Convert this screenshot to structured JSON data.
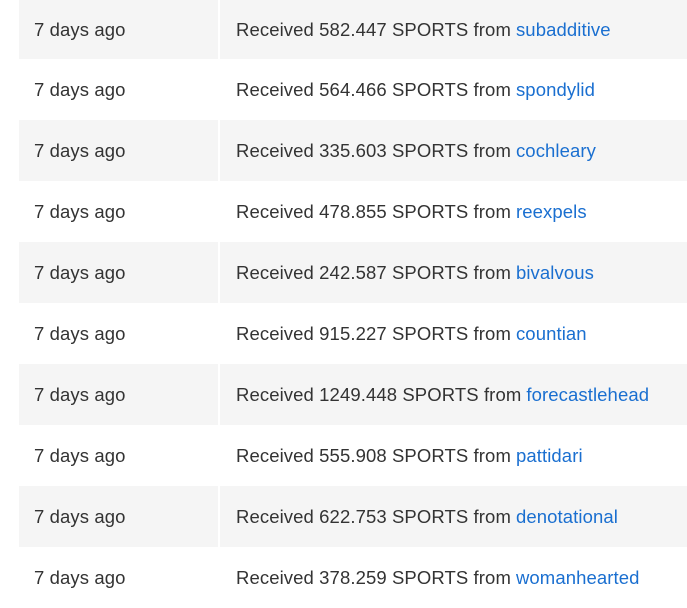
{
  "transactions": [
    {
      "time": "7 days ago",
      "text": "Received 582.447 SPORTS from",
      "user": "subadditive"
    },
    {
      "time": "7 days ago",
      "text": "Received 564.466 SPORTS from",
      "user": "spondylid"
    },
    {
      "time": "7 days ago",
      "text": "Received 335.603 SPORTS from",
      "user": "cochleary"
    },
    {
      "time": "7 days ago",
      "text": "Received 478.855 SPORTS from",
      "user": "reexpels"
    },
    {
      "time": "7 days ago",
      "text": "Received 242.587 SPORTS from",
      "user": "bivalvous"
    },
    {
      "time": "7 days ago",
      "text": "Received 915.227 SPORTS from",
      "user": "countian"
    },
    {
      "time": "7 days ago",
      "text": "Received 1249.448 SPORTS from",
      "user": "forecastlehead"
    },
    {
      "time": "7 days ago",
      "text": "Received 555.908 SPORTS from",
      "user": "pattidari"
    },
    {
      "time": "7 days ago",
      "text": "Received 622.753 SPORTS from",
      "user": "denotational"
    },
    {
      "time": "7 days ago",
      "text": "Received 378.259 SPORTS from",
      "user": "womanhearted"
    }
  ],
  "colors": {
    "link": "#1a6fd0",
    "text": "#333333",
    "row_shade": "#f5f5f5"
  }
}
